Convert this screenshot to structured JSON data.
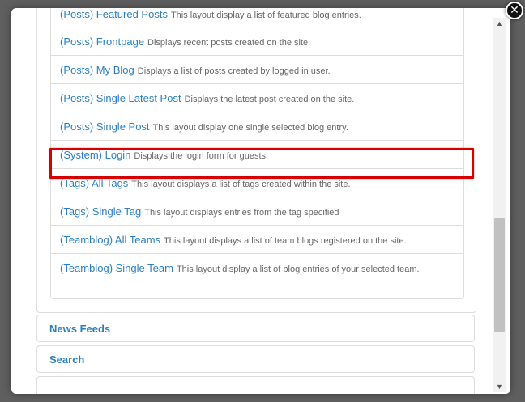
{
  "layouts": [
    {
      "title": "(Posts) Featured Posts",
      "desc": "This layout display a list of featured blog entries."
    },
    {
      "title": "(Posts) Frontpage",
      "desc": "Displays recent posts created on the site."
    },
    {
      "title": "(Posts) My Blog",
      "desc": "Displays a list of posts created by logged in user."
    },
    {
      "title": "(Posts) Single Latest Post",
      "desc": "Displays the latest post created on the site."
    },
    {
      "title": "(Posts) Single Post",
      "desc": "This layout display one single selected blog entry."
    },
    {
      "title": "(System) Login",
      "desc": "Displays the login form for guests."
    },
    {
      "title": "(Tags) All Tags",
      "desc": "This layout displays a list of tags created within the site."
    },
    {
      "title": "(Tags) Single Tag",
      "desc": "This layout displays entries from the tag specified"
    },
    {
      "title": "(Teamblog) All Teams",
      "desc": "This layout displays a list of team blogs registered on the site."
    },
    {
      "title": "(Teamblog) Single Team",
      "desc": "This layout display a list of blog entries of your selected team."
    }
  ],
  "sections": [
    {
      "title": "News Feeds"
    },
    {
      "title": "Search"
    }
  ],
  "highlighted_item": "(System) Login",
  "highlight_color": "#d60000",
  "link_color": "#2a7fc1",
  "close_button": {
    "icon": "close-icon",
    "glyph": "✕"
  },
  "scrollbar": {
    "up_glyph": "▲",
    "down_glyph": "▼"
  }
}
